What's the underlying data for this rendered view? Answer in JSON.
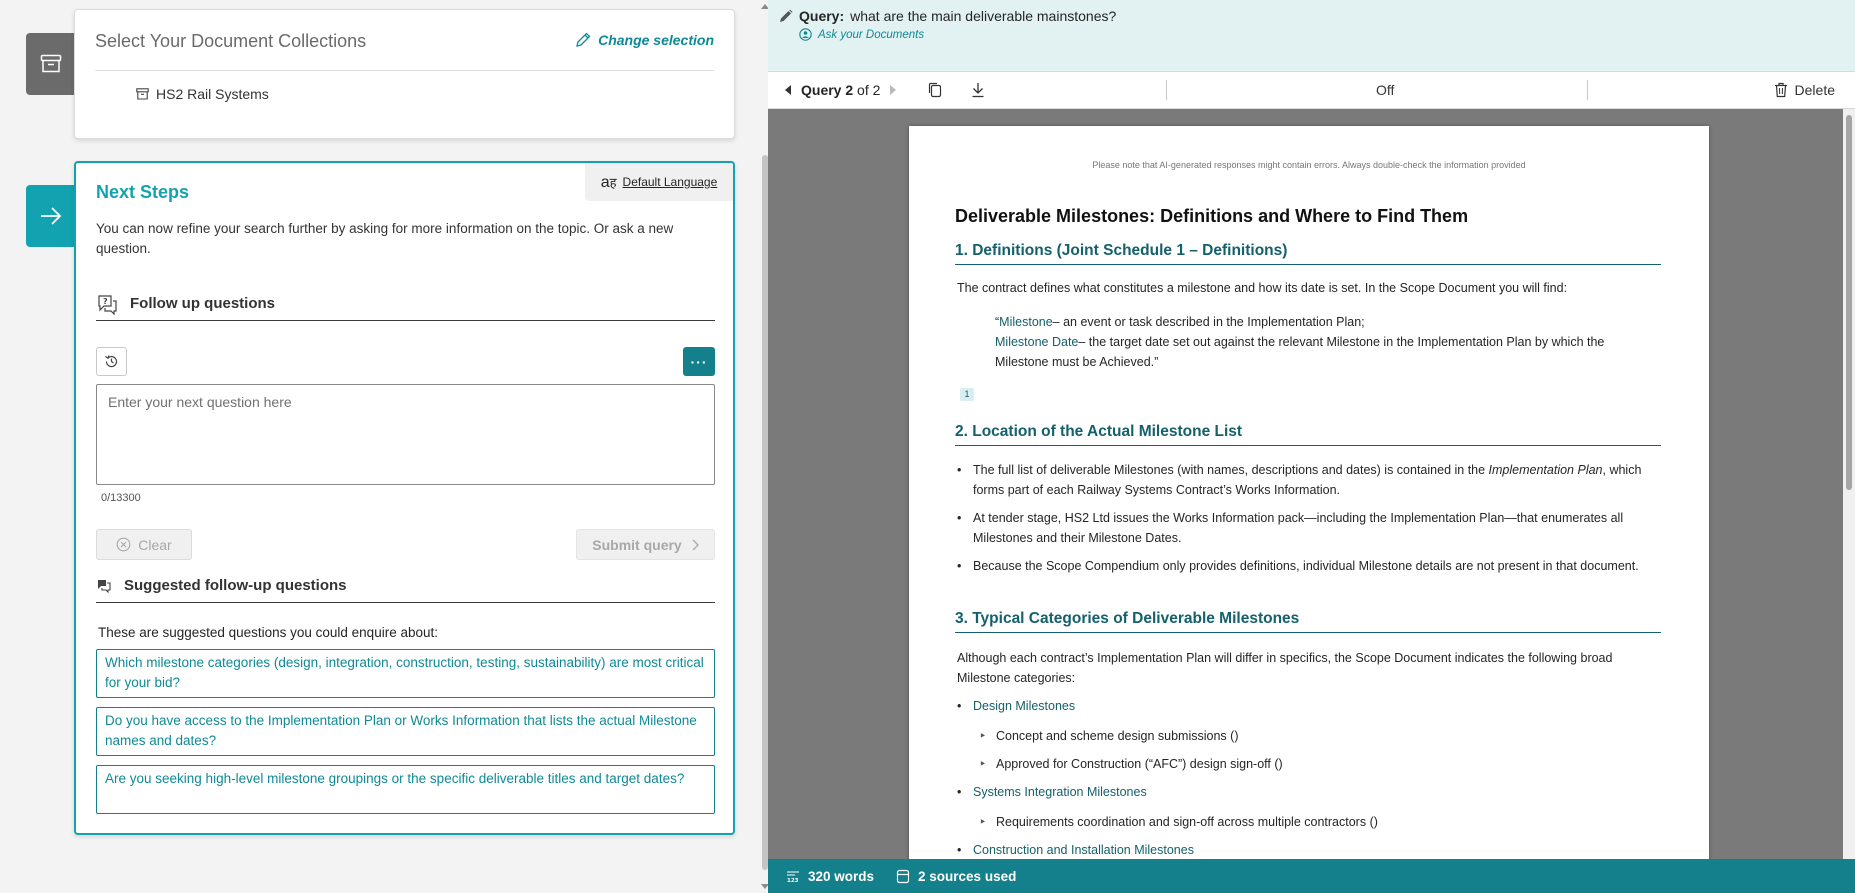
{
  "collections": {
    "title": "Select Your Document Collections",
    "change_label": "Change selection",
    "items": [
      {
        "label": "HS2 Rail Systems"
      }
    ]
  },
  "next_steps": {
    "language_label": "Default Language",
    "title": "Next Steps",
    "description": "You can now refine your search further by asking for more information on the topic. Or ask a new question.",
    "follow_up_title": "Follow up questions",
    "input_placeholder": "Enter your next question here",
    "input_value": "",
    "counter": "0/13300",
    "clear_label": "Clear",
    "submit_label": "Submit query",
    "suggested_title": "Suggested follow-up questions",
    "suggested_intro": "These are suggested questions you could enquire about:",
    "suggestions": [
      "Which milestone categories (design, integration, construction, testing, sustainability) are most critical for your bid?",
      "Do you have access to the Implementation Plan or Works Information that lists the actual Milestone names and dates?",
      "Are you seeking high-level milestone groupings or the specific deliverable titles and target dates?"
    ]
  },
  "query_bar": {
    "query_label": "Query:",
    "query_text": "what are the main deliverable mainstones?",
    "ask_label": "Ask your Documents"
  },
  "nav": {
    "query_word": "Query",
    "current": "2",
    "of_text": "of 2",
    "toggle_state": "Off",
    "delete_label": "Delete"
  },
  "document": {
    "disclaimer": "Please note that AI-generated responses might contain errors. Always double-check the information provided",
    "title": "Deliverable Milestones: Definitions and Where to Find Them",
    "sections": [
      {
        "heading": "1. Definitions (Joint Schedule 1 – Definitions)"
      },
      {
        "heading": "2. Location of the Actual Milestone List"
      },
      {
        "heading": "3. Typical Categories of Deliverable Milestones"
      }
    ],
    "s1_intro": "The contract defines what constitutes a milestone and how its date is set. In the Scope Document you will find:",
    "quote_term1": "Milestone",
    "quote_rest1": "– an event or task described in the Implementation Plan;",
    "quote_open": "“",
    "quote_term2": "Milestone Date",
    "quote_rest2": "– the target date set out against the relevant Milestone in the Implementation Plan by which the Milestone must be Achieved.”",
    "citation": "1",
    "s2_bullet1_a": "The full list of deliverable Milestones (with names, descriptions and dates) is contained in the ",
    "s2_bullet1_em": "Implementation Plan",
    "s2_bullet1_b": ", which forms part of each Railway Systems Contract’s Works Information.",
    "s2_bullet2": "At tender stage, HS2 Ltd issues the Works Information pack—including the Implementation Plan—that enumerates all Milestones and their Milestone Dates.",
    "s2_bullet3": "Because the Scope Compendium only provides definitions, individual Milestone details are not present in that document.",
    "s3_intro": "Although each contract’s Implementation Plan will differ in specifics, the Scope Document indicates the following broad Milestone categories:",
    "categories": [
      {
        "name": "Design Milestones",
        "subs": [
          "Concept and scheme design submissions ()",
          "Approved for Construction (“AFC”) design sign-off ()"
        ]
      },
      {
        "name": "Systems Integration Milestones",
        "subs": [
          "Requirements coordination and sign-off across multiple contractors ()"
        ]
      },
      {
        "name": "Construction and Installation Milestones",
        "subs": []
      }
    ]
  },
  "status": {
    "words": "320 words",
    "sources": "2 sources used"
  },
  "colors": {
    "accent": "#13a3b0",
    "accent_dark": "#14808b",
    "heading": "#14606b",
    "query_bg": "#e2f1f2"
  }
}
